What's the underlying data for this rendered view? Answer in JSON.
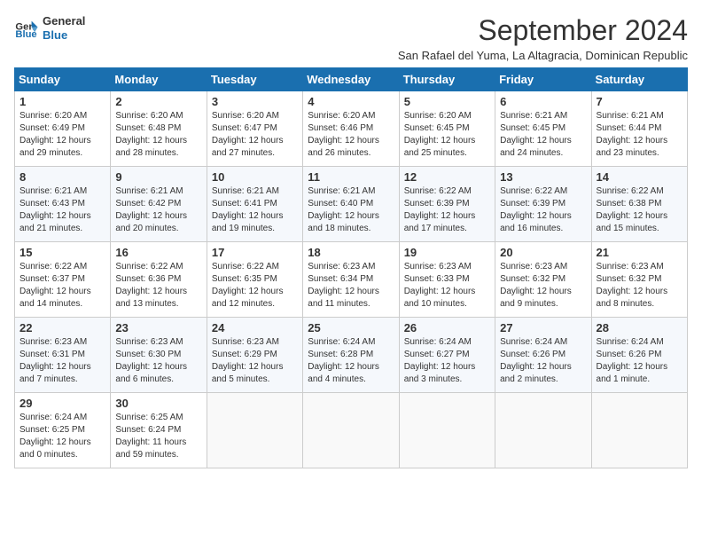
{
  "logo": {
    "line1": "General",
    "line2": "Blue"
  },
  "title": "September 2024",
  "subtitle": "San Rafael del Yuma, La Altagracia, Dominican Republic",
  "days_header": [
    "Sunday",
    "Monday",
    "Tuesday",
    "Wednesday",
    "Thursday",
    "Friday",
    "Saturday"
  ],
  "weeks": [
    [
      {
        "day": "1",
        "rise": "6:20 AM",
        "set": "6:49 PM",
        "daylight": "12 hours and 29 minutes."
      },
      {
        "day": "2",
        "rise": "6:20 AM",
        "set": "6:48 PM",
        "daylight": "12 hours and 28 minutes."
      },
      {
        "day": "3",
        "rise": "6:20 AM",
        "set": "6:47 PM",
        "daylight": "12 hours and 27 minutes."
      },
      {
        "day": "4",
        "rise": "6:20 AM",
        "set": "6:46 PM",
        "daylight": "12 hours and 26 minutes."
      },
      {
        "day": "5",
        "rise": "6:20 AM",
        "set": "6:45 PM",
        "daylight": "12 hours and 25 minutes."
      },
      {
        "day": "6",
        "rise": "6:21 AM",
        "set": "6:45 PM",
        "daylight": "12 hours and 24 minutes."
      },
      {
        "day": "7",
        "rise": "6:21 AM",
        "set": "6:44 PM",
        "daylight": "12 hours and 23 minutes."
      }
    ],
    [
      {
        "day": "8",
        "rise": "6:21 AM",
        "set": "6:43 PM",
        "daylight": "12 hours and 21 minutes."
      },
      {
        "day": "9",
        "rise": "6:21 AM",
        "set": "6:42 PM",
        "daylight": "12 hours and 20 minutes."
      },
      {
        "day": "10",
        "rise": "6:21 AM",
        "set": "6:41 PM",
        "daylight": "12 hours and 19 minutes."
      },
      {
        "day": "11",
        "rise": "6:21 AM",
        "set": "6:40 PM",
        "daylight": "12 hours and 18 minutes."
      },
      {
        "day": "12",
        "rise": "6:22 AM",
        "set": "6:39 PM",
        "daylight": "12 hours and 17 minutes."
      },
      {
        "day": "13",
        "rise": "6:22 AM",
        "set": "6:39 PM",
        "daylight": "12 hours and 16 minutes."
      },
      {
        "day": "14",
        "rise": "6:22 AM",
        "set": "6:38 PM",
        "daylight": "12 hours and 15 minutes."
      }
    ],
    [
      {
        "day": "15",
        "rise": "6:22 AM",
        "set": "6:37 PM",
        "daylight": "12 hours and 14 minutes."
      },
      {
        "day": "16",
        "rise": "6:22 AM",
        "set": "6:36 PM",
        "daylight": "12 hours and 13 minutes."
      },
      {
        "day": "17",
        "rise": "6:22 AM",
        "set": "6:35 PM",
        "daylight": "12 hours and 12 minutes."
      },
      {
        "day": "18",
        "rise": "6:23 AM",
        "set": "6:34 PM",
        "daylight": "12 hours and 11 minutes."
      },
      {
        "day": "19",
        "rise": "6:23 AM",
        "set": "6:33 PM",
        "daylight": "12 hours and 10 minutes."
      },
      {
        "day": "20",
        "rise": "6:23 AM",
        "set": "6:32 PM",
        "daylight": "12 hours and 9 minutes."
      },
      {
        "day": "21",
        "rise": "6:23 AM",
        "set": "6:32 PM",
        "daylight": "12 hours and 8 minutes."
      }
    ],
    [
      {
        "day": "22",
        "rise": "6:23 AM",
        "set": "6:31 PM",
        "daylight": "12 hours and 7 minutes."
      },
      {
        "day": "23",
        "rise": "6:23 AM",
        "set": "6:30 PM",
        "daylight": "12 hours and 6 minutes."
      },
      {
        "day": "24",
        "rise": "6:23 AM",
        "set": "6:29 PM",
        "daylight": "12 hours and 5 minutes."
      },
      {
        "day": "25",
        "rise": "6:24 AM",
        "set": "6:28 PM",
        "daylight": "12 hours and 4 minutes."
      },
      {
        "day": "26",
        "rise": "6:24 AM",
        "set": "6:27 PM",
        "daylight": "12 hours and 3 minutes."
      },
      {
        "day": "27",
        "rise": "6:24 AM",
        "set": "6:26 PM",
        "daylight": "12 hours and 2 minutes."
      },
      {
        "day": "28",
        "rise": "6:24 AM",
        "set": "6:26 PM",
        "daylight": "12 hours and 1 minute."
      }
    ],
    [
      {
        "day": "29",
        "rise": "6:24 AM",
        "set": "6:25 PM",
        "daylight": "12 hours and 0 minutes."
      },
      {
        "day": "30",
        "rise": "6:25 AM",
        "set": "6:24 PM",
        "daylight": "11 hours and 59 minutes."
      },
      null,
      null,
      null,
      null,
      null
    ]
  ],
  "labels": {
    "sunrise": "Sunrise:",
    "sunset": "Sunset:",
    "daylight": "Daylight:"
  }
}
